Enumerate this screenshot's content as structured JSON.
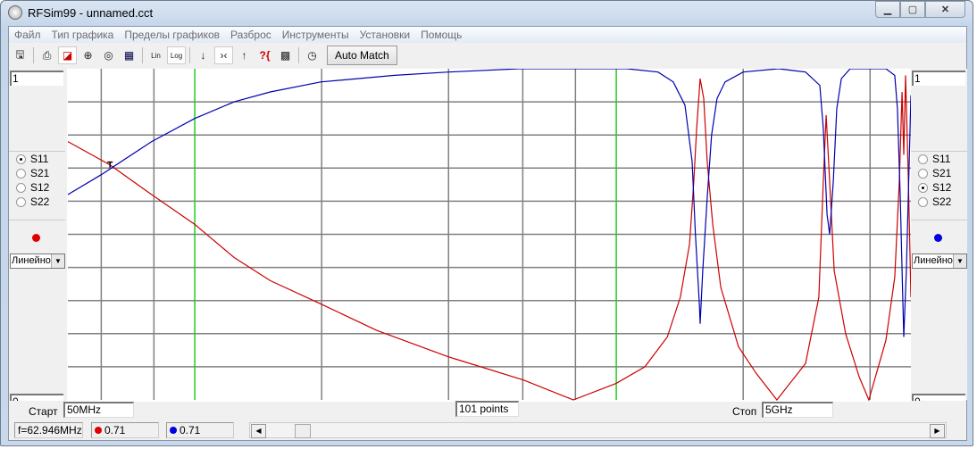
{
  "window": {
    "title": "RFSim99 - unnamed.cct"
  },
  "menu": [
    "Файл",
    "Тип графика",
    "Пределы графиков",
    "Разброс",
    "Инструменты",
    "Установки",
    "Помощь"
  ],
  "toolbar": {
    "auto_match": "Auto Match",
    "lin": "Lin",
    "log": "Log"
  },
  "left_panel": {
    "top_value": "1",
    "bottom_value": "0",
    "params": [
      "S11",
      "S21",
      "S12",
      "S22"
    ],
    "selected": "S11",
    "color": "#e00000",
    "scale": "Линейно"
  },
  "right_panel": {
    "top_value": "1",
    "bottom_value": "0",
    "params": [
      "S11",
      "S21",
      "S12",
      "S22"
    ],
    "selected": "S12",
    "color": "#0000e0",
    "scale": "Линейно"
  },
  "bottom": {
    "start_label": "Старт",
    "start_value": "50MHz",
    "points_value": "101 points",
    "stop_label": "Стоп",
    "stop_value": "5GHz"
  },
  "status": {
    "freq": "f=62.946MHz",
    "s11_value": "0.71",
    "s12_value": "0.71"
  },
  "chart_data": {
    "type": "line",
    "xscale": "log",
    "xlim": [
      50,
      5000
    ],
    "ylim": [
      0,
      1
    ],
    "grid": true,
    "xgrid": [
      60,
      80,
      100,
      200,
      400,
      600,
      800,
      1000,
      2000,
      4000
    ],
    "decade_lines": [
      100,
      1000
    ],
    "marker": {
      "f": 62.946,
      "value": 0.71
    },
    "series": [
      {
        "name": "S11",
        "color": "#cc0000",
        "points": [
          [
            50,
            0.78
          ],
          [
            62.9,
            0.71
          ],
          [
            79,
            0.62
          ],
          [
            100,
            0.53
          ],
          [
            124,
            0.43
          ],
          [
            151,
            0.36
          ],
          [
            199,
            0.29
          ],
          [
            270,
            0.21
          ],
          [
            400,
            0.13
          ],
          [
            602,
            0.06
          ],
          [
            791,
            0.0
          ],
          [
            1000,
            0.05
          ],
          [
            1169,
            0.1
          ],
          [
            1321,
            0.19
          ],
          [
            1419,
            0.31
          ],
          [
            1492,
            0.47
          ],
          [
            1527,
            0.66
          ],
          [
            1551,
            0.82
          ],
          [
            1581,
            0.97
          ],
          [
            1612,
            0.91
          ],
          [
            1643,
            0.72
          ],
          [
            1694,
            0.53
          ],
          [
            1770,
            0.34
          ],
          [
            1950,
            0.16
          ],
          [
            2148,
            0.08
          ],
          [
            2404,
            0.0
          ],
          [
            2812,
            0.11
          ],
          [
            3024,
            0.31
          ],
          [
            3099,
            0.66
          ],
          [
            3147,
            0.86
          ],
          [
            3207,
            0.66
          ],
          [
            3288,
            0.39
          ],
          [
            3500,
            0.2
          ],
          [
            3767,
            0.07
          ],
          [
            3973,
            0.0
          ],
          [
            4362,
            0.18
          ],
          [
            4578,
            0.37
          ],
          [
            4692,
            0.66
          ],
          [
            4764,
            0.93
          ],
          [
            4809,
            0.74
          ],
          [
            4855,
            0.98
          ],
          [
            4931,
            0.66
          ],
          [
            5000,
            0.31
          ]
        ]
      },
      {
        "name": "S12",
        "color": "#0000b0",
        "points": [
          [
            50,
            0.62
          ],
          [
            60,
            0.68
          ],
          [
            79,
            0.78
          ],
          [
            100,
            0.85
          ],
          [
            124,
            0.9
          ],
          [
            151,
            0.93
          ],
          [
            199,
            0.96
          ],
          [
            298,
            0.98
          ],
          [
            400,
            0.99
          ],
          [
            590,
            1.0
          ],
          [
            1059,
            1.0
          ],
          [
            1256,
            0.99
          ],
          [
            1365,
            0.96
          ],
          [
            1455,
            0.89
          ],
          [
            1513,
            0.72
          ],
          [
            1541,
            0.5
          ],
          [
            1574,
            0.29
          ],
          [
            1581,
            0.23
          ],
          [
            1604,
            0.39
          ],
          [
            1643,
            0.61
          ],
          [
            1683,
            0.8
          ],
          [
            1734,
            0.91
          ],
          [
            1812,
            0.96
          ],
          [
            1999,
            0.99
          ],
          [
            2427,
            1.0
          ],
          [
            2812,
            0.99
          ],
          [
            3040,
            0.95
          ],
          [
            3099,
            0.82
          ],
          [
            3162,
            0.56
          ],
          [
            3207,
            0.5
          ],
          [
            3272,
            0.66
          ],
          [
            3335,
            0.88
          ],
          [
            3419,
            0.97
          ],
          [
            3588,
            1.0
          ],
          [
            4362,
            1.0
          ],
          [
            4578,
            0.98
          ],
          [
            4645,
            0.88
          ],
          [
            4718,
            0.61
          ],
          [
            4764,
            0.39
          ],
          [
            4809,
            0.19
          ],
          [
            4877,
            0.39
          ],
          [
            4954,
            0.72
          ],
          [
            5000,
            0.92
          ]
        ]
      }
    ]
  }
}
